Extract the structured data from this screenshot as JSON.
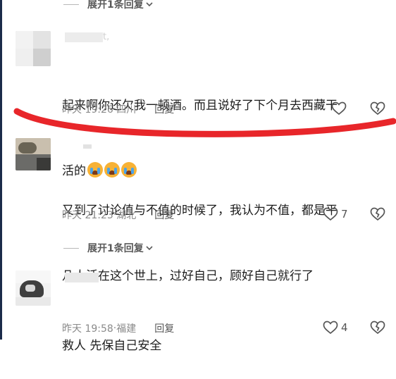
{
  "top_expand": {
    "label": "展开1条回复"
  },
  "comments": [
    {
      "username": "t,",
      "text_line1": "起来啊你还欠我一顿酒。而且说好了下个月去西藏干",
      "text_line2": "活的",
      "emojis": [
        "crying-face-icon",
        "crying-face-icon",
        "crying-face-icon"
      ],
      "time": "昨天 19:26",
      "location": "四川",
      "reply_label": "回复",
      "like_count": ""
    },
    {
      "text_line1": "又到了讨论值与不值的时候了，我认为不值，都是平",
      "text_line2": "凡人活在这个世上，过好自己，顾好自己就行了",
      "time": "昨天 21:23",
      "location": "湖北",
      "reply_label": "回复",
      "like_count": "7"
    },
    {
      "text_line1": "救人 先保自己安全",
      "time": "昨天 19:58",
      "location": "福建",
      "reply_label": "回复",
      "like_count": "4"
    }
  ],
  "mid_expand": {
    "label": "展开1条回复"
  },
  "separator": "·",
  "colors": {
    "annotation_red": "#e8262a",
    "muted_text": "#8a8a8a",
    "left_edge": "#1b2b4a"
  }
}
